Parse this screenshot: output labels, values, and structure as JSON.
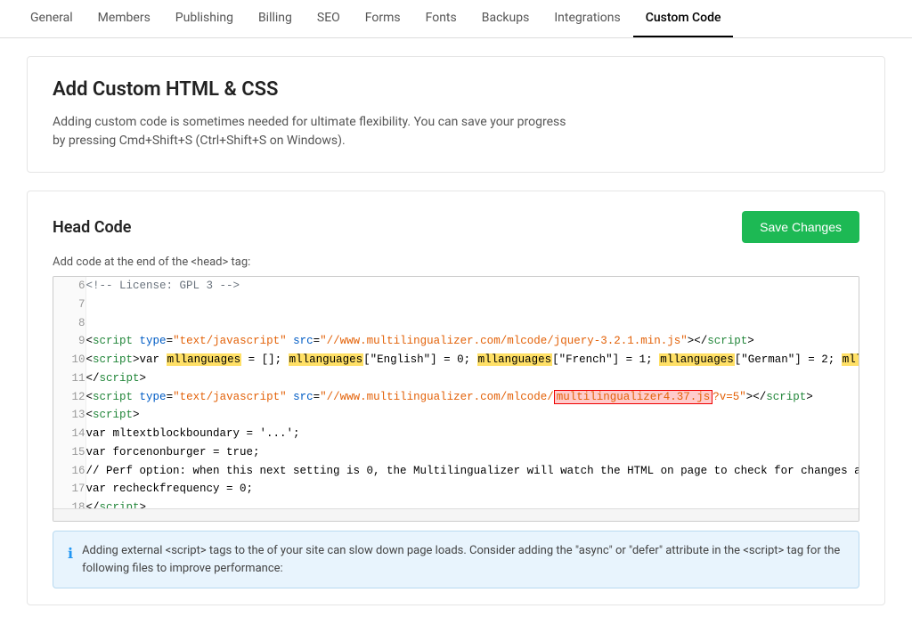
{
  "nav": {
    "items": [
      {
        "label": "General",
        "active": false
      },
      {
        "label": "Members",
        "active": false
      },
      {
        "label": "Publishing",
        "active": false
      },
      {
        "label": "Billing",
        "active": false
      },
      {
        "label": "SEO",
        "active": false
      },
      {
        "label": "Forms",
        "active": false
      },
      {
        "label": "Fonts",
        "active": false
      },
      {
        "label": "Backups",
        "active": false
      },
      {
        "label": "Integrations",
        "active": false
      },
      {
        "label": "Custom Code",
        "active": true
      }
    ]
  },
  "add_html_section": {
    "title": "Add Custom HTML & CSS",
    "description": "Adding custom code is sometimes needed for ultimate flexibility. You can save your progress\nby pressing Cmd+Shift+S (Ctrl+Shift+S on Windows)."
  },
  "head_code_section": {
    "title": "Head Code",
    "save_button": "Save Changes",
    "add_code_label": "Add code at the end of the <head> tag:"
  },
  "info_box": {
    "text": "Adding external <script> tags to the of your site can slow down page loads. Consider adding the \"async\" or \"defer\" attribute in the <script> tag for the following files to improve performance:"
  }
}
